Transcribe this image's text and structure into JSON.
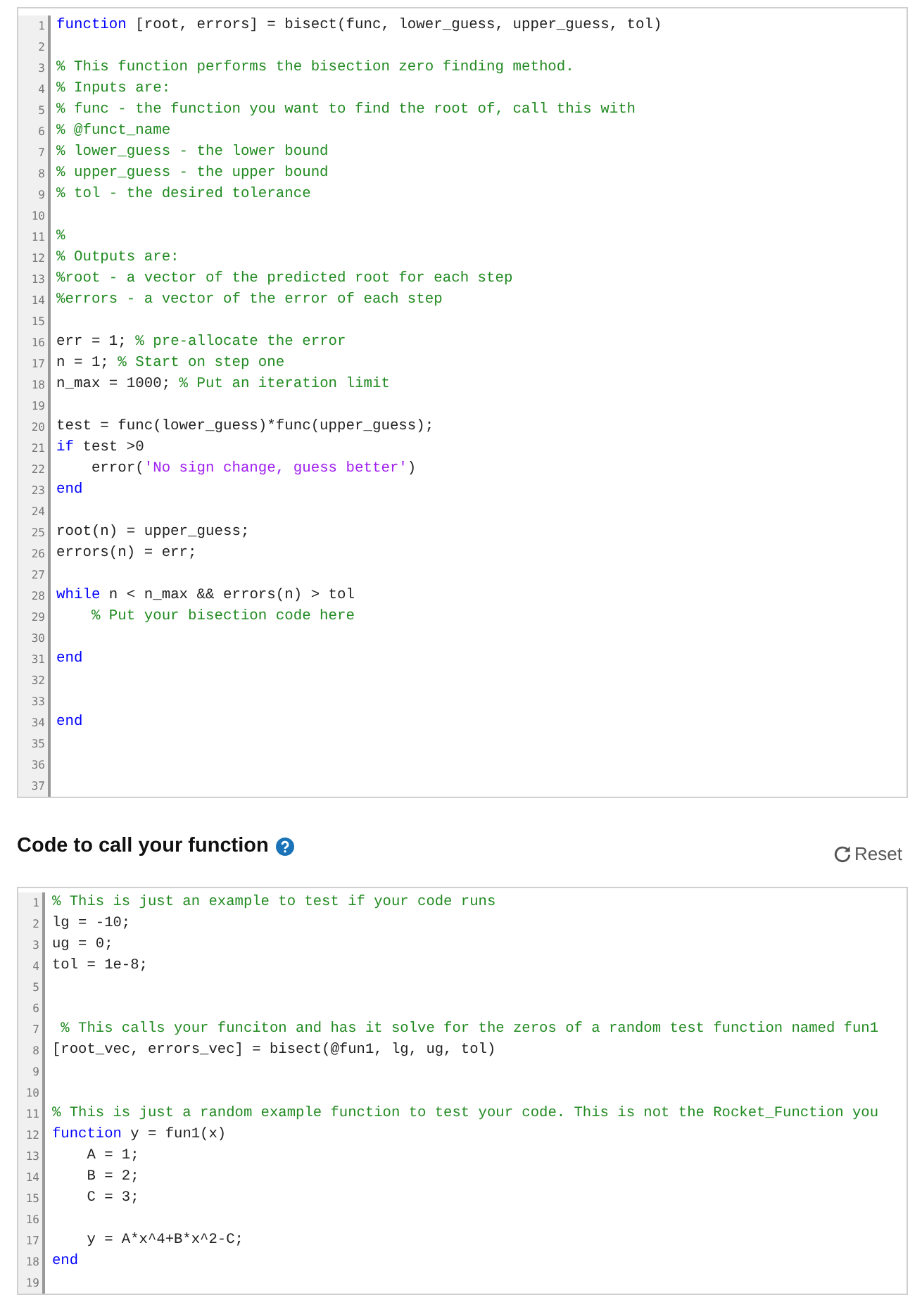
{
  "main_editor": {
    "lines": [
      {
        "number": "1",
        "segments": [
          {
            "kind": "keyword",
            "text": "function"
          },
          {
            "kind": "plain",
            "text": " [root, errors] = bisect(func, lower_guess, upper_guess, tol)"
          }
        ]
      },
      {
        "number": "2"
      },
      {
        "number": "3",
        "segments": [
          {
            "kind": "comment",
            "text": "% This function performs the bisection zero finding method."
          }
        ]
      },
      {
        "number": "4",
        "segments": [
          {
            "kind": "comment",
            "text": "% Inputs are:"
          }
        ]
      },
      {
        "number": "5",
        "segments": [
          {
            "kind": "comment",
            "text": "% func - the function you want to find the root of, call this with"
          }
        ]
      },
      {
        "number": "6",
        "segments": [
          {
            "kind": "comment",
            "text": "% @funct_name"
          }
        ]
      },
      {
        "number": "7",
        "segments": [
          {
            "kind": "comment",
            "text": "% lower_guess - the lower bound"
          }
        ]
      },
      {
        "number": "8",
        "segments": [
          {
            "kind": "comment",
            "text": "% upper_guess - the upper bound"
          }
        ]
      },
      {
        "number": "9",
        "segments": [
          {
            "kind": "comment",
            "text": "% tol - the desired tolerance"
          }
        ]
      },
      {
        "number": "10"
      },
      {
        "number": "11",
        "segments": [
          {
            "kind": "comment",
            "text": "%"
          }
        ]
      },
      {
        "number": "12",
        "segments": [
          {
            "kind": "comment",
            "text": "% Outputs are:"
          }
        ]
      },
      {
        "number": "13",
        "segments": [
          {
            "kind": "comment",
            "text": "%root - a vector of the predicted root for each step"
          }
        ]
      },
      {
        "number": "14",
        "segments": [
          {
            "kind": "comment",
            "text": "%errors - a vector of the error of each step"
          }
        ]
      },
      {
        "number": "15"
      },
      {
        "number": "16",
        "segments": [
          {
            "kind": "plain",
            "text": "err = 1; "
          },
          {
            "kind": "comment",
            "text": "% pre-allocate the error"
          }
        ]
      },
      {
        "number": "17",
        "segments": [
          {
            "kind": "plain",
            "text": "n = 1; "
          },
          {
            "kind": "comment",
            "text": "% Start on step one"
          }
        ]
      },
      {
        "number": "18",
        "segments": [
          {
            "kind": "plain",
            "text": "n_max = 1000; "
          },
          {
            "kind": "comment",
            "text": "% Put an iteration limit"
          }
        ]
      },
      {
        "number": "19"
      },
      {
        "number": "20",
        "segments": [
          {
            "kind": "plain",
            "text": "test = func(lower_guess)*func(upper_guess);"
          }
        ]
      },
      {
        "number": "21",
        "segments": [
          {
            "kind": "keyword",
            "text": "if"
          },
          {
            "kind": "plain",
            "text": " test >0"
          }
        ]
      },
      {
        "number": "22",
        "segments": [
          {
            "kind": "plain",
            "text": "    error("
          },
          {
            "kind": "string",
            "text": "'No sign change, guess better'"
          },
          {
            "kind": "plain",
            "text": ")"
          }
        ]
      },
      {
        "number": "23",
        "segments": [
          {
            "kind": "keyword",
            "text": "end"
          }
        ]
      },
      {
        "number": "24"
      },
      {
        "number": "25",
        "segments": [
          {
            "kind": "plain",
            "text": "root(n) = upper_guess;"
          }
        ]
      },
      {
        "number": "26",
        "segments": [
          {
            "kind": "plain",
            "text": "errors(n) = err;"
          }
        ]
      },
      {
        "number": "27"
      },
      {
        "number": "28",
        "segments": [
          {
            "kind": "keyword",
            "text": "while"
          },
          {
            "kind": "plain",
            "text": " n < n_max && errors(n) > tol"
          }
        ]
      },
      {
        "number": "29",
        "segments": [
          {
            "kind": "comment",
            "text": "    % Put your bisection code here"
          }
        ]
      },
      {
        "number": "30"
      },
      {
        "number": "31",
        "segments": [
          {
            "kind": "keyword",
            "text": "end"
          }
        ]
      },
      {
        "number": "32"
      },
      {
        "number": "33"
      },
      {
        "number": "34",
        "segments": [
          {
            "kind": "keyword",
            "text": "end"
          }
        ]
      },
      {
        "number": "35"
      },
      {
        "number": "36"
      },
      {
        "number": "37"
      }
    ]
  },
  "call_section": {
    "title": "Code to call your function",
    "reset_button": "Reset",
    "editor": {
      "lines": [
        {
          "number": "1",
          "segments": [
            {
              "kind": "comment",
              "text": "% This is just an example to test if your code runs"
            }
          ]
        },
        {
          "number": "2",
          "segments": [
            {
              "kind": "plain",
              "text": "lg = -10;"
            }
          ]
        },
        {
          "number": "3",
          "segments": [
            {
              "kind": "plain",
              "text": "ug = 0;"
            }
          ]
        },
        {
          "number": "4",
          "segments": [
            {
              "kind": "plain",
              "text": "tol = 1e-8;"
            }
          ]
        },
        {
          "number": "5"
        },
        {
          "number": "6"
        },
        {
          "number": "7",
          "segments": [
            {
              "kind": "comment",
              "text": " % This calls your funciton and has it solve for the zeros of a random test function named fun1"
            }
          ]
        },
        {
          "number": "8",
          "segments": [
            {
              "kind": "plain",
              "text": "[root_vec, errors_vec] = bisect(@fun1, lg, ug, tol)"
            }
          ]
        },
        {
          "number": "9"
        },
        {
          "number": "10"
        },
        {
          "number": "11",
          "segments": [
            {
              "kind": "comment",
              "text": "% This is just a random example function to test your code. This is not the Rocket_Function you"
            }
          ]
        },
        {
          "number": "12",
          "segments": [
            {
              "kind": "keyword",
              "text": "function"
            },
            {
              "kind": "plain",
              "text": " y = fun1(x)"
            }
          ]
        },
        {
          "number": "13",
          "segments": [
            {
              "kind": "plain",
              "text": "    A = 1;"
            }
          ]
        },
        {
          "number": "14",
          "segments": [
            {
              "kind": "plain",
              "text": "    B = 2;"
            }
          ]
        },
        {
          "number": "15",
          "segments": [
            {
              "kind": "plain",
              "text": "    C = 3;"
            }
          ]
        },
        {
          "number": "16"
        },
        {
          "number": "17",
          "segments": [
            {
              "kind": "plain",
              "text": "    y = A*x^4+B*x^2-C;"
            }
          ]
        },
        {
          "number": "18",
          "segments": [
            {
              "kind": "keyword",
              "text": "end"
            }
          ]
        },
        {
          "number": "19"
        }
      ]
    }
  }
}
